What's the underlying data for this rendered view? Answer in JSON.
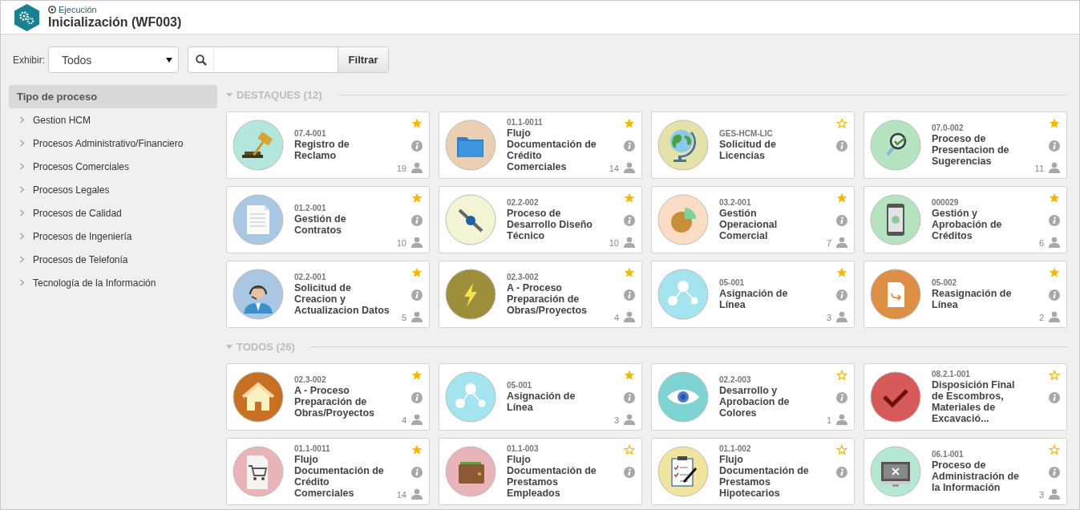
{
  "header": {
    "breadcrumb": "Ejecución",
    "title": "Inicialización (WF003)"
  },
  "toolbar": {
    "show_label": "Exhibir:",
    "show_value": "Todos",
    "filter_button": "Filtrar"
  },
  "sidebar": {
    "title": "Tipo de proceso",
    "items": [
      {
        "label": "Gestion HCM",
        "expanded": false
      },
      {
        "label": "Procesos Administrativo/Financiero",
        "expanded": false
      },
      {
        "label": "Procesos Comerciales",
        "expanded": false
      },
      {
        "label": "Procesos Legales",
        "expanded": false
      },
      {
        "label": "Procesos de Calidad",
        "expanded": false
      },
      {
        "label": "Procesos de Ingeniería",
        "expanded": false
      },
      {
        "label": "Procesos de Telefonía",
        "expanded": false
      },
      {
        "label": "Tecnología de la Información",
        "expanded": false
      }
    ]
  },
  "sections": [
    {
      "title": "DESTAQUES (12)",
      "expanded": true,
      "cards": [
        {
          "code": "07.4-001",
          "title": "Registro de Reclamo",
          "starred": true,
          "count": "19",
          "kind": "gavel",
          "color": "#b3e6dc"
        },
        {
          "code": "01.1-0011",
          "title": "Flujo Documentación de Crédito Comerciales",
          "starred": true,
          "count": "14",
          "kind": "folder",
          "color": "#ebcfb2"
        },
        {
          "code": "GES-HCM-LIC",
          "title": "Solicitud de Licencias",
          "starred": false,
          "kind": "globe",
          "color": "#e4e2a8"
        },
        {
          "code": "07.0-002",
          "title": "Proceso de Presentacion de Sugerencias",
          "starred": true,
          "count": "11",
          "kind": "magnifier",
          "color": "#b5e3bf"
        },
        {
          "code": "01.2-001",
          "title": "Gestión de Contratos",
          "starred": true,
          "count": "10",
          "kind": "document",
          "color": "#a9c6e3"
        },
        {
          "code": "02.2-002",
          "title": "Proceso de Desarrollo Diseño Técnico",
          "starred": true,
          "count": "10",
          "kind": "wrench",
          "color": "#f2f4d4"
        },
        {
          "code": "03.2-001",
          "title": "Gestión Operacional Comercial",
          "starred": true,
          "count": "7",
          "kind": "pie",
          "color": "#fbdcc4"
        },
        {
          "code": "000029",
          "title": "Gestión y Aprobación de Créditos",
          "starred": true,
          "count": "6",
          "kind": "phone",
          "color": "#b5e3bf"
        },
        {
          "code": "02.2-001",
          "title": "Solicitud de Creacion y Actualizacion Datos",
          "starred": true,
          "count": "5",
          "kind": "agent",
          "color": "#a9c6e3"
        },
        {
          "code": "02.3-002",
          "title": "A - Proceso Preparación de Obras/Proyectos",
          "starred": true,
          "count": "4",
          "kind": "bolt",
          "color": "#9c8e3a"
        },
        {
          "code": "05-001",
          "title": "Asignación de Línea",
          "starred": true,
          "count": "3",
          "kind": "network",
          "color": "#a4e4ee"
        },
        {
          "code": "05-002",
          "title": "Reasignación de Línea",
          "starred": true,
          "count": "2",
          "kind": "file",
          "color": "#dc8f45"
        }
      ]
    },
    {
      "title": "TODOS (26)",
      "expanded": true,
      "cards": [
        {
          "code": "02.3-002",
          "title": "A - Proceso Preparación de Obras/Proyectos",
          "starred": true,
          "count": "4",
          "kind": "house",
          "color": "#c76f22"
        },
        {
          "code": "05-001",
          "title": "Asignación de Línea",
          "starred": true,
          "count": "3",
          "kind": "network",
          "color": "#a4e4ee"
        },
        {
          "code": "02.2-003",
          "title": "Desarrollo y Aprobacion de Colores",
          "starred": false,
          "count": "1",
          "kind": "eye",
          "color": "#7dd4d3"
        },
        {
          "code": "08.2.1-001",
          "title": "Disposición Final de Escombros, Materiales de Excavació...",
          "starred": false,
          "kind": "check",
          "color": "#d65a5a"
        },
        {
          "code": "01.1-0011",
          "title": "Flujo Documentación de Crédito Comerciales",
          "starred": true,
          "count": "14",
          "kind": "cart",
          "color": "#e8b4b8"
        },
        {
          "code": "01.1-003",
          "title": "Flujo Documentación de Prestamos Empleados",
          "starred": false,
          "kind": "wallet",
          "color": "#e8b4b8"
        },
        {
          "code": "01.1-002",
          "title": "Flujo Documentación de Prestamos Hipotecarios",
          "starred": false,
          "kind": "clipboard",
          "color": "#f0e49e"
        },
        {
          "code": "06.1-001",
          "title": "Proceso de Administración de la Información",
          "starred": false,
          "count": "3",
          "kind": "monitor",
          "color": "#b4e8d2"
        }
      ]
    }
  ]
}
